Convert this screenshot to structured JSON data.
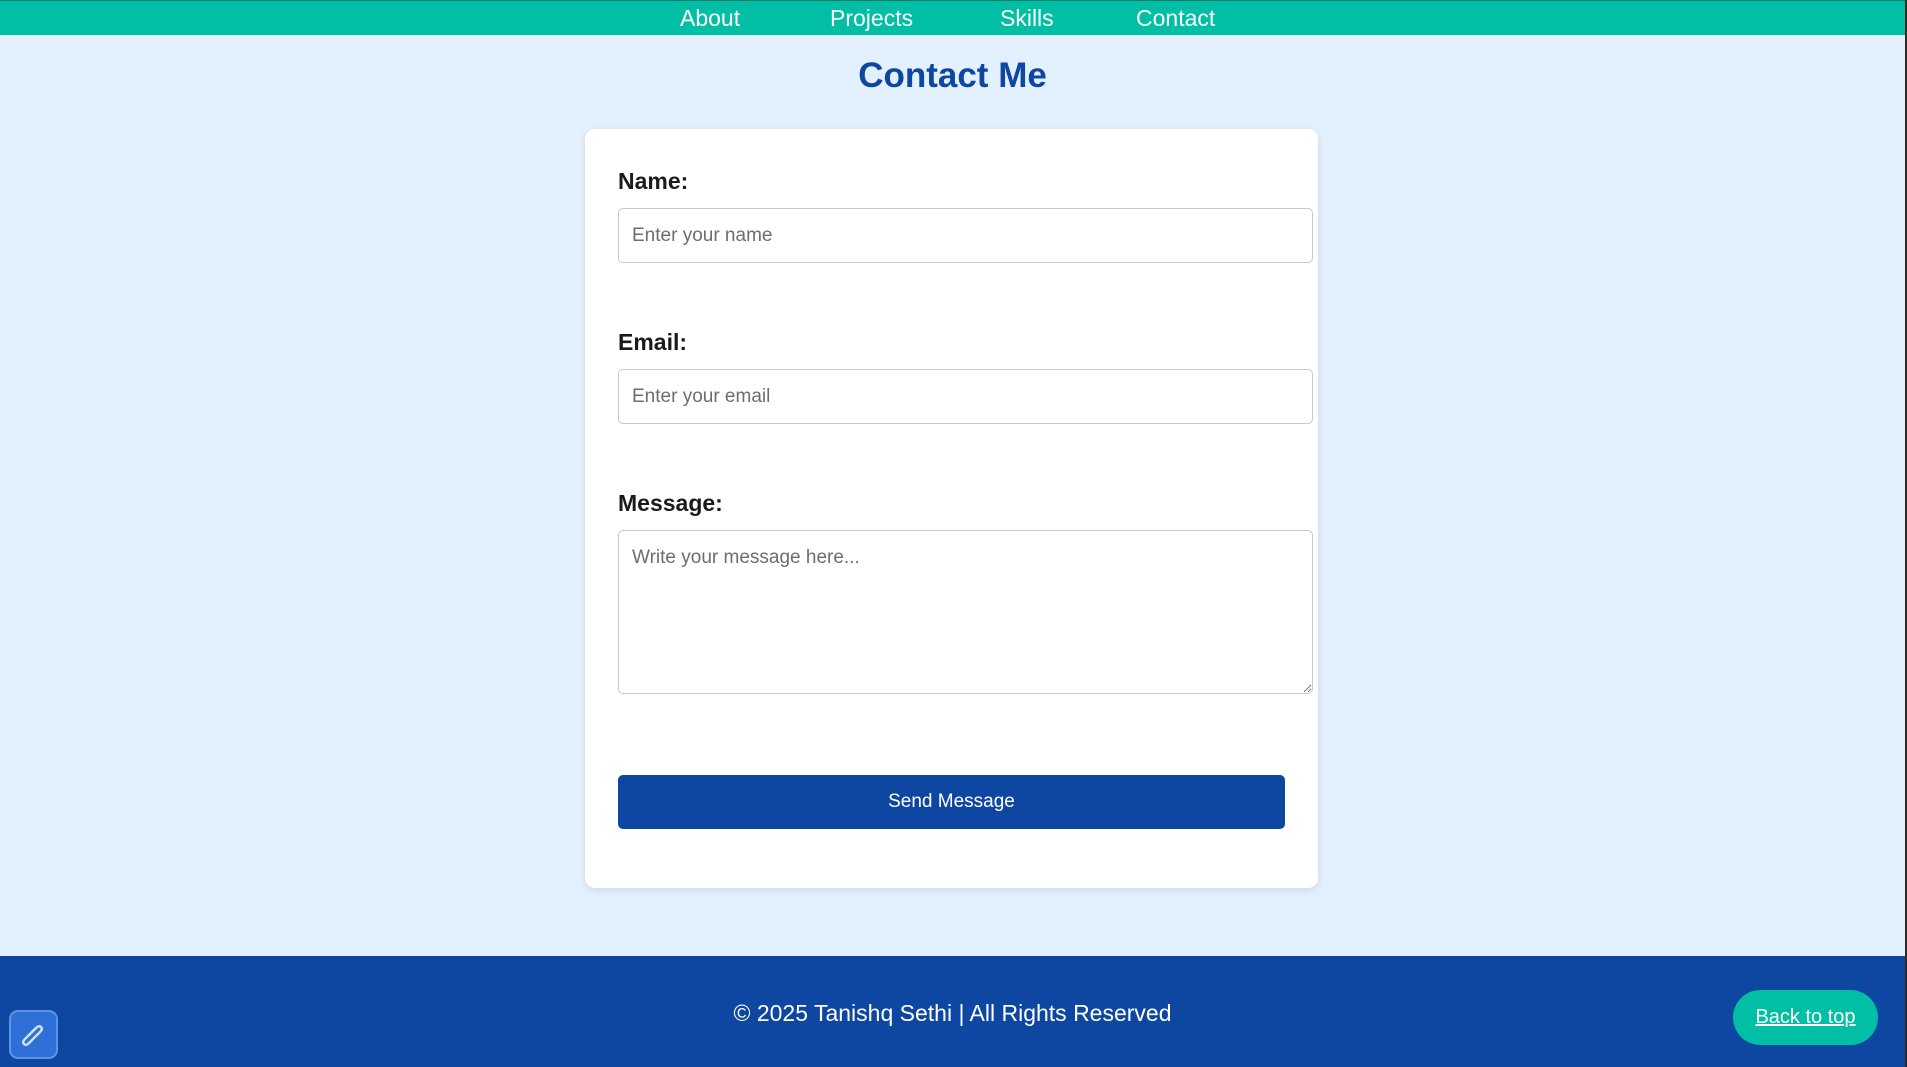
{
  "nav": {
    "items": [
      {
        "label": "About"
      },
      {
        "label": "Projects"
      },
      {
        "label": "Skills"
      },
      {
        "label": "Contact"
      }
    ]
  },
  "page": {
    "title": "Contact Me"
  },
  "form": {
    "name_label": "Name:",
    "name_placeholder": "Enter your name",
    "email_label": "Email:",
    "email_placeholder": "Enter your email",
    "message_label": "Message:",
    "message_placeholder": "Write your message here...",
    "submit_label": "Send Message"
  },
  "footer": {
    "copyright": "© 2025 Tanishq Sethi | All Rights Reserved",
    "back_to_top": "Back to top"
  },
  "colors": {
    "nav_bg": "#00bfa5",
    "page_bg": "#e3f0fd",
    "primary": "#0d47a1",
    "accent": "#00bfa5"
  },
  "icons": {
    "corner_badge": "pen-badge-icon"
  }
}
